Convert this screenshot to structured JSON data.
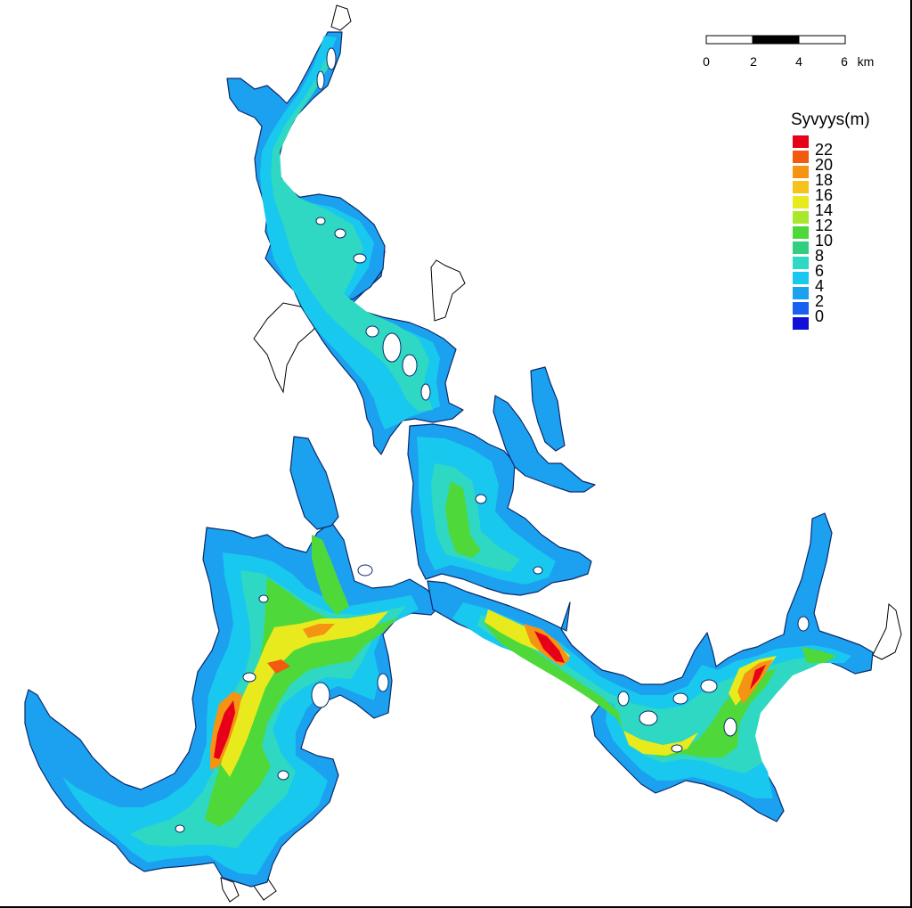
{
  "map": {
    "name": "depth-map",
    "legend": {
      "title": "Syvyys(m)",
      "labels": [
        "22",
        "20",
        "18",
        "16",
        "14",
        "12",
        "10",
        "8",
        "6",
        "4",
        "2",
        "0"
      ],
      "colors": [
        "#e8001a",
        "#f25a10",
        "#f59312",
        "#f7c21c",
        "#e8ea1e",
        "#a8e82a",
        "#4fd83a",
        "#2fcf7f",
        "#2fd8c2",
        "#19c8ee",
        "#1ca0f0",
        "#1860f0",
        "#1010d8"
      ]
    },
    "scale_bar": {
      "labels": [
        "0",
        "2",
        "4",
        "6"
      ],
      "unit": "km"
    },
    "palette": {
      "shallow": "#1ca0f0",
      "mid": "#19c8ee",
      "teal": "#2fd8c2",
      "green": "#4fd83a",
      "yellow": "#e8ea1e",
      "deep": "#e8001a",
      "land_outline": "#000000"
    }
  }
}
